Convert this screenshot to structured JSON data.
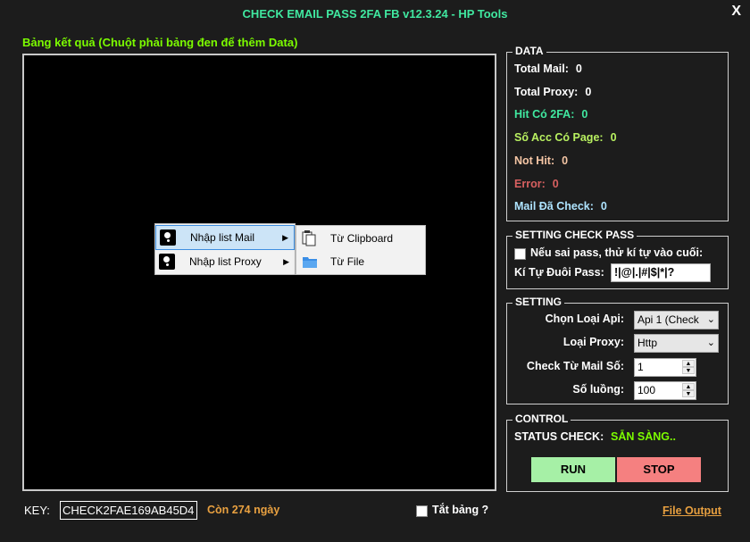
{
  "window": {
    "title": "CHECK EMAIL PASS 2FA FB v12.3.24 - HP Tools",
    "close": "X"
  },
  "results": {
    "label": "Bảng kết quả (Chuột phải bảng đen để thêm Data)"
  },
  "context_menu": {
    "items": [
      {
        "label": "Nhập list Mail",
        "icon": "pin-icon"
      },
      {
        "label": "Nhập list Proxy",
        "icon": "pin-icon"
      }
    ],
    "submenu": [
      {
        "label": "Từ Clipboard",
        "icon": "clipboard-icon"
      },
      {
        "label": "Từ File",
        "icon": "folder-icon"
      }
    ]
  },
  "data": {
    "title": "DATA",
    "rows": [
      {
        "label": "Total Mail:",
        "value": "0",
        "color": "#ffffff"
      },
      {
        "label": "Total Proxy:",
        "value": "0",
        "color": "#ffffff"
      },
      {
        "label": "Hit Có 2FA:",
        "value": "0",
        "color": "#40e8a0"
      },
      {
        "label": "Số Acc Có Page:",
        "value": "0",
        "color": "#b8f060"
      },
      {
        "label": "Not Hit:",
        "value": "0",
        "color": "#f5c6a5"
      },
      {
        "label": "Error:",
        "value": "0",
        "color": "#d86060"
      },
      {
        "label": "Mail Đã Check:",
        "value": "0",
        "color": "#aee4ff"
      }
    ]
  },
  "setting_check_pass": {
    "title": "SETTING CHECK PASS",
    "checkbox_label": "Nếu sai pass, thử kí tự vào cuối:",
    "suffix_label": "Kí Tự Đuôi Pass:",
    "suffix_value": "!|@|.|#|$|*|?"
  },
  "setting": {
    "title": "SETTING",
    "api_label": "Chọn Loại Api:",
    "api_value": "Api 1 (Check",
    "proxy_label": "Loại Proxy:",
    "proxy_value": "Http",
    "from_label": "Check Từ Mail Số:",
    "from_value": "1",
    "threads_label": "Số luồng:",
    "threads_value": "100"
  },
  "control": {
    "title": "CONTROL",
    "status_label": "STATUS CHECK:",
    "status_value": "SẴN SÀNG..",
    "run_label": "RUN",
    "stop_label": "STOP",
    "run_color": "#a6f0a6",
    "stop_color": "#f58080"
  },
  "footer": {
    "key_label": "KEY:",
    "key_value": "CHECK2FAE169AB45D4",
    "days_left": "Còn 274 ngày",
    "toggle_label": "Tắt bảng ?",
    "output_link": "File Output"
  }
}
